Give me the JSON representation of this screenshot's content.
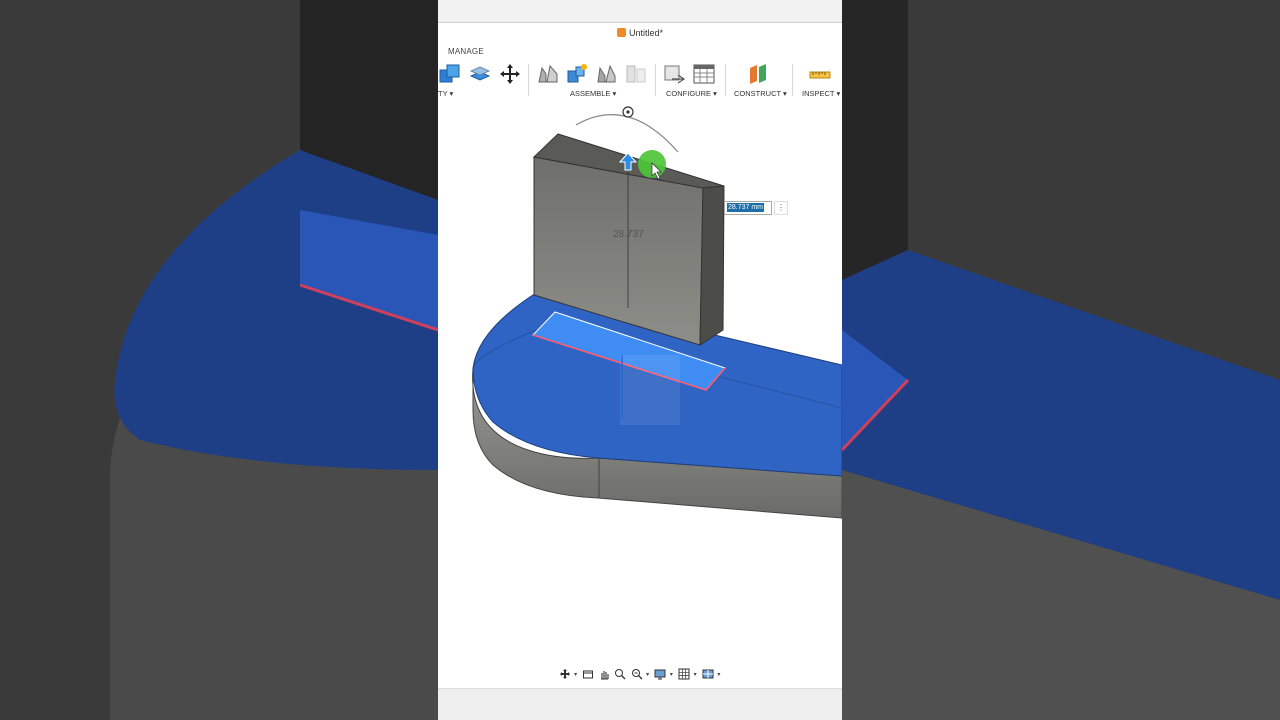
{
  "document": {
    "title": "Untitled*"
  },
  "ribbon": {
    "active_tab": "MANAGE",
    "groups": [
      {
        "label": "TY ▾"
      },
      {
        "label": "ASSEMBLE ▾"
      },
      {
        "label": "CONFIGURE ▾"
      },
      {
        "label": "CONSTRUCT ▾"
      },
      {
        "label": "INSPECT ▾"
      }
    ]
  },
  "viewport": {
    "dimension_label": "28.737",
    "dimension_input_value": "28.737 mm",
    "dimension_menu_glyph": "⋮"
  },
  "navigation": {
    "tools": [
      "orbit-icon",
      "look-at-icon",
      "pan-icon",
      "zoom-icon",
      "fit-icon",
      "display-settings-icon",
      "grid-icon",
      "viewports-icon"
    ]
  },
  "colors": {
    "selected_face": "#2f64c4",
    "body_gray": "#8b8b86",
    "cursor_highlight": "#4fc43a",
    "sketch_outline": "#ff5c6c",
    "brand_orange": "#f08a24"
  }
}
